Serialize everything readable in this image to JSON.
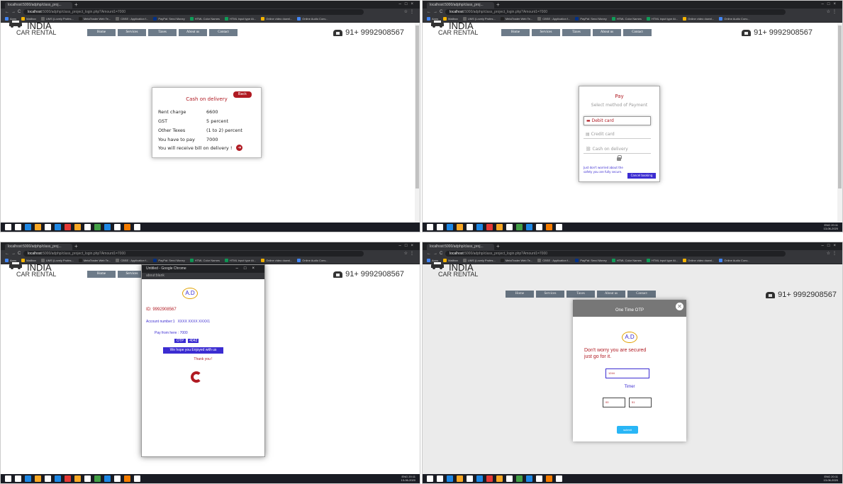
{
  "browser": {
    "tab_label": "localhost:5000/adphp/class_proj...",
    "url_host": "localhost",
    "url_path": ":5000/adphp/class_project_login.php?Amount1=7000",
    "url_path_short": ":5000/adphp/class_project_login.php?Amount1=7000",
    "bookmarks": [
      {
        "label": "Apps",
        "color": "#4285f4"
      },
      {
        "label": "Mailbox",
        "color": "#f4b400"
      },
      {
        "label": "UMS (Lovely Profes...",
        "color": "#666666"
      },
      {
        "label": "MetaTrader Web Te...",
        "color": "#222222"
      },
      {
        "label": "CBSE : Application f...",
        "color": "#666666"
      },
      {
        "label": "PayPal: Send Money",
        "color": "#003087"
      },
      {
        "label": "HTML Color Names",
        "color": "#0f9d58"
      },
      {
        "label": "HTML input type At...",
        "color": "#0f9d58"
      },
      {
        "label": "Online video downl...",
        "color": "#f4b400"
      },
      {
        "label": "Online Audio Conv...",
        "color": "#4285f4"
      }
    ]
  },
  "site": {
    "logo_line1": "INDIA",
    "logo_line2": "CAR RENTAL",
    "nav": [
      "Home",
      "Services",
      "Taxes",
      "About us",
      "Contact"
    ],
    "phone": "91+ 9992908567"
  },
  "cash_card": {
    "back_label": "Back",
    "title": "Cash on delivery",
    "rows": [
      {
        "label": "Rent charge",
        "value": "6600"
      },
      {
        "label": "GST",
        "value": "5 percent"
      },
      {
        "label": "Other Texes",
        "value": "(1 to 2) percent"
      },
      {
        "label": "You have to pay",
        "value": "7000"
      }
    ],
    "bill_note": "You will receive bill on delivery !"
  },
  "pay_card": {
    "title": "Pay",
    "subtitle": "Select method of Payment",
    "options": [
      "Debit card",
      "Credit card",
      "Cash on delivery"
    ],
    "safety_note": "Just don't worried about the safety you are fully secure.",
    "cancel_label": "Cancel booking"
  },
  "receipt": {
    "window_title": "Untitled - Google Chrome",
    "window_url": "about:blank",
    "logo": "A.D",
    "id_line": "ID: 9992908567",
    "account_label": "Account number:1",
    "account_value": "XXXX XXXX XXXX1",
    "pay_line": "Pay from here : 7000",
    "otp_label": "OTP",
    "otp_value": "4042",
    "hope_line": "We hope you Enjoyed with us",
    "thanks": "Thank you !"
  },
  "otp_modal": {
    "title": "One Time OTP",
    "logo": "A.D",
    "message": "Don't worry you are secured just go for it.",
    "otp_input_value": "1244",
    "timer_label": "Timer",
    "timer_min": "00",
    "timer_sec": "51",
    "submit_label": "submit"
  },
  "taskbar": {
    "time": "20:11",
    "date": "13-06-2020",
    "lang": "ENG",
    "icon_colors": [
      "#ffffff",
      "#ffffff",
      "#1e88e5",
      "#f9a825",
      "#ffffff",
      "#1e88e5",
      "#e53935",
      "#f9a825",
      "#ffffff",
      "#43a047",
      "#1e88e5",
      "#ffffff",
      "#f57c00",
      "#ffffff"
    ]
  }
}
